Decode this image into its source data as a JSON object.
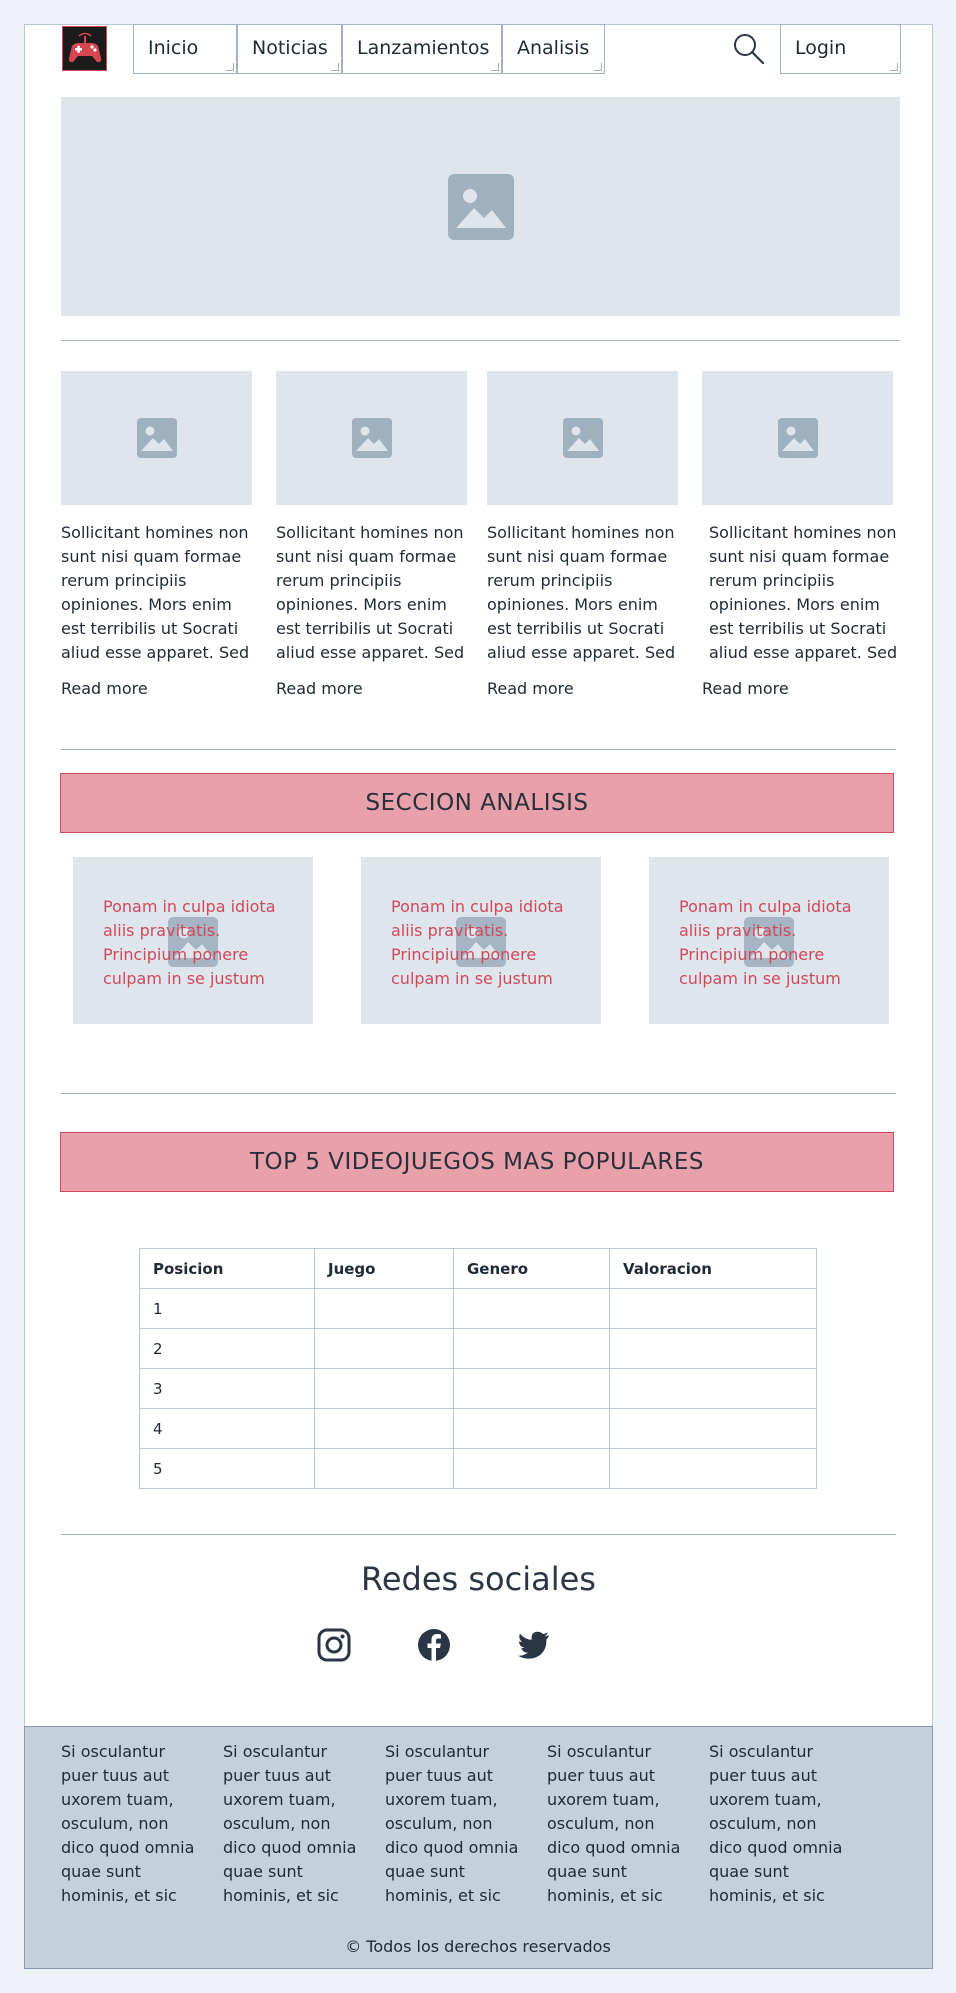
{
  "nav": {
    "items": [
      "Inicio",
      "Noticias",
      "Lanzamientos",
      "Analisis"
    ],
    "login_label": "Login"
  },
  "news": {
    "cards": [
      {
        "text": "Sollicitant homines non sunt nisi quam formae rerum principiis opiniones. Mors enim est terribilis ut Socrati aliud esse apparet. Sed",
        "link": "Read more"
      },
      {
        "text": "Sollicitant homines non sunt nisi quam formae rerum principiis opiniones. Mors enim est terribilis ut Socrati aliud esse apparet. Sed",
        "link": "Read more"
      },
      {
        "text": "Sollicitant homines non sunt nisi quam formae rerum principiis opiniones. Mors enim est terribilis ut Socrati aliud esse apparet. Sed",
        "link": "Read more"
      },
      {
        "text": "Sollicitant homines non sunt nisi quam formae rerum principiis opiniones. Mors enim est terribilis ut Socrati aliud esse apparet. Sed",
        "link": "Read more"
      }
    ]
  },
  "analysis": {
    "title": "SECCION ANALISIS",
    "cards": [
      {
        "text": "Ponam in culpa idiota aliis pravitatis. Principium ponere culpam in se justum"
      },
      {
        "text": "Ponam in culpa idiota aliis pravitatis. Principium ponere culpam in se justum"
      },
      {
        "text": "Ponam in culpa idiota aliis pravitatis. Principium ponere culpam in se justum"
      }
    ]
  },
  "top5": {
    "title": "TOP 5 VIDEOJUEGOS MAS POPULARES",
    "headers": [
      "Posicion",
      "Juego",
      "Genero",
      "Valoracion"
    ],
    "rows": [
      [
        "1",
        "",
        "",
        ""
      ],
      [
        "2",
        "",
        "",
        ""
      ],
      [
        "3",
        "",
        "",
        ""
      ],
      [
        "4",
        "",
        "",
        ""
      ],
      [
        "5",
        "",
        "",
        ""
      ]
    ]
  },
  "social": {
    "title": "Redes sociales",
    "icons": [
      "instagram-icon",
      "facebook-icon",
      "twitter-icon"
    ]
  },
  "footer": {
    "columns": [
      "Si osculantur puer tuus aut uxorem tuam, osculum, non dico quod omnia quae sunt hominis, et sic",
      "Si osculantur puer tuus aut uxorem tuam, osculum, non dico quod omnia quae sunt hominis, et sic",
      "Si osculantur puer tuus aut uxorem tuam, osculum, non dico quod omnia quae sunt hominis, et sic",
      "Si osculantur puer tuus aut uxorem tuam, osculum, non dico quod omnia quae sunt hominis, et sic",
      "Si osculantur puer tuus aut uxorem tuam, osculum, non dico quod omnia quae sunt hominis, et sic"
    ],
    "copyright": "© Todos los derechos reservados"
  },
  "colors": {
    "accent": "#d0495a",
    "banner_bg": "#e8a1aa",
    "placeholder_bg": "#dfe5ed",
    "footer_bg": "#c4d1dc"
  }
}
